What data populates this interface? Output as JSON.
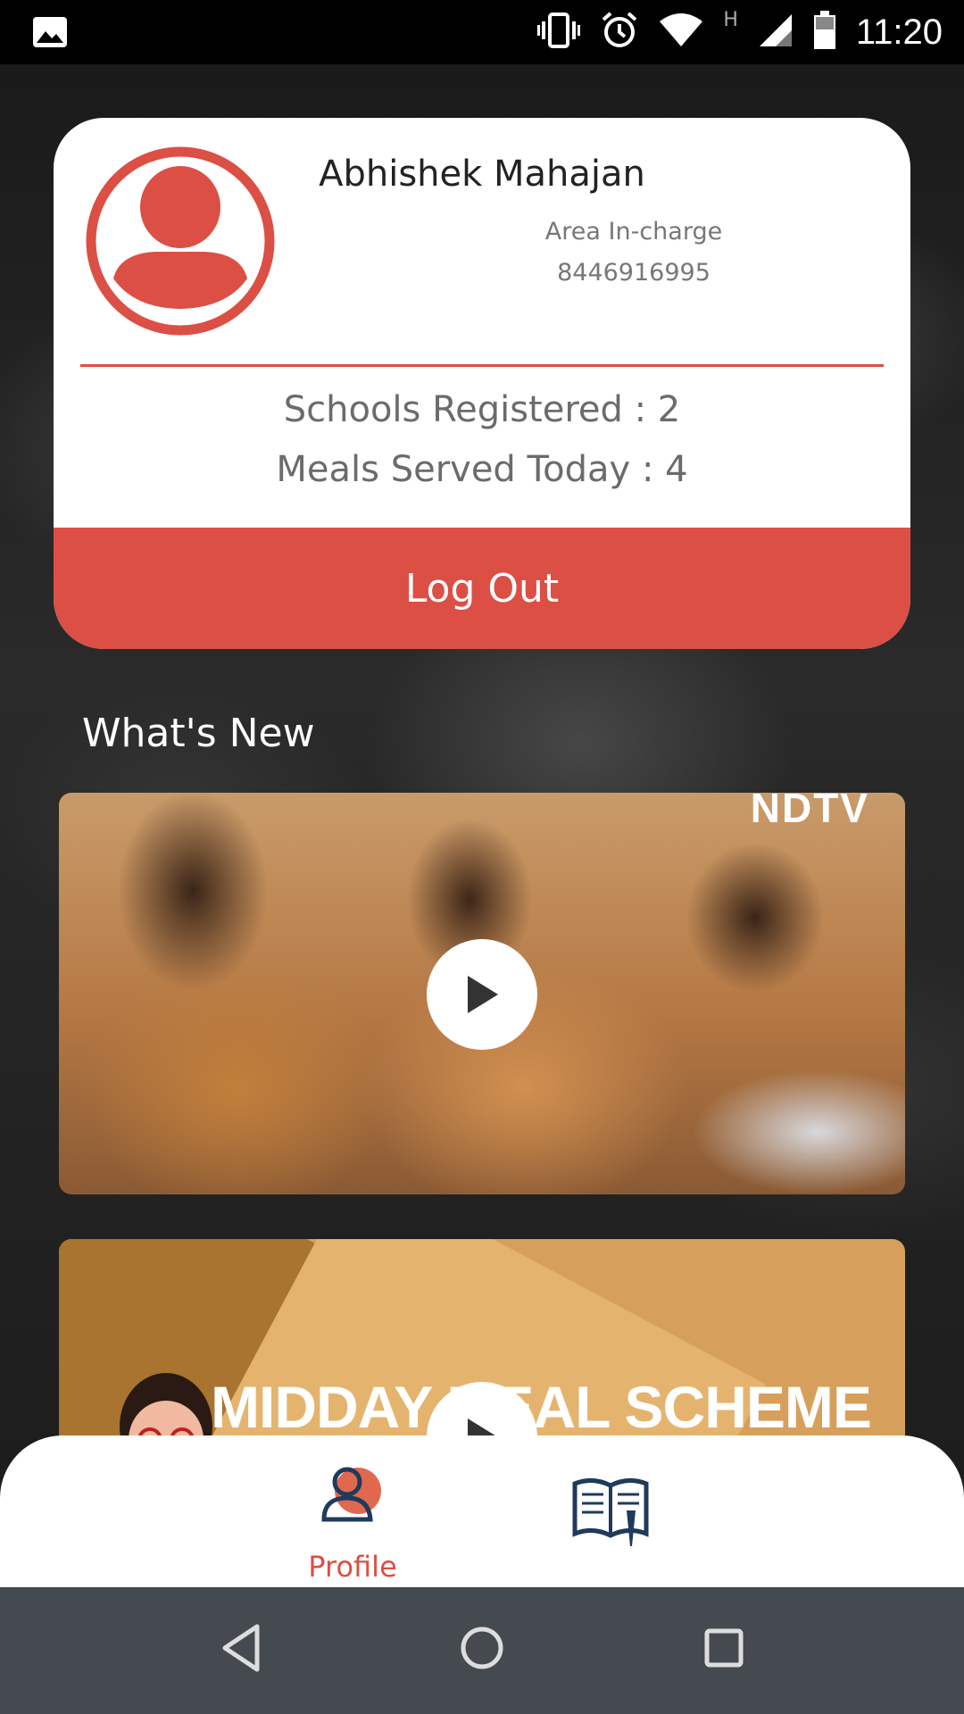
{
  "status_bar": {
    "time": "11:20",
    "network_label": "H",
    "icons": [
      "image-icon",
      "vibrate-icon",
      "alarm-icon",
      "wifi-icon",
      "signal-icon",
      "battery-icon"
    ]
  },
  "profile": {
    "name": "Abhishek Mahajan",
    "role": "Area In-charge",
    "phone": "8446916995",
    "schools_registered": "Schools Registered : 2",
    "meals_served": "Meals Served Today : 4",
    "logout_label": "Log Out"
  },
  "whats_new": {
    "heading": "What's New",
    "videos": [
      {
        "watermark": "NDTV"
      },
      {
        "title": "MIDDAY MEAL SCHEME"
      }
    ]
  },
  "bottom_nav": {
    "items": [
      {
        "label": "Profile",
        "icon": "profile-icon",
        "active": true
      },
      {
        "label": "",
        "icon": "book-icon",
        "active": false
      }
    ]
  },
  "colors": {
    "accent": "#dc4f45",
    "nav_inactive": "#1f3a5c",
    "system_nav": "#454a50"
  }
}
